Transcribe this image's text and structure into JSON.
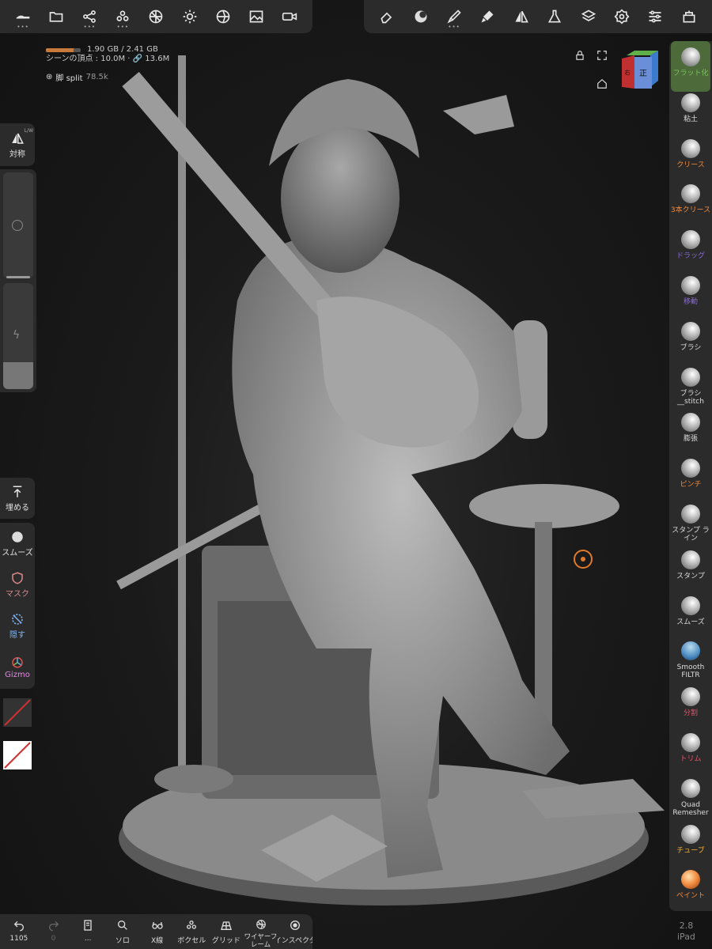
{
  "stats": {
    "memory": "1.90 GB / 2.41 GB",
    "memory_fraction": 0.79,
    "scene_vertices": "シーンの頂点 : 10.0M · ",
    "scene_link": "13.6M",
    "object_name": "脚 split",
    "object_count": "78.5k"
  },
  "top_left_tools": [
    "file-icon",
    "folder-icon",
    "scene-graph-icon",
    "multiresolution-icon",
    "topology-icon",
    "lighting-icon",
    "material-icon",
    "image-icon",
    "camera-icon"
  ],
  "top_right_tools": [
    "eraser-icon",
    "material-sphere-icon",
    "brush-icon",
    "paint-icon",
    "symmetry-icon",
    "flask-icon",
    "layers-icon",
    "settings-icon",
    "sliders-icon",
    "reference-icon"
  ],
  "cube": {
    "front_label": "正",
    "right_label": "右"
  },
  "left_panel": {
    "symmetry_label": "対称",
    "symmetry_badge": "L/W",
    "fill_label": "埋める",
    "smooth_label": "スムーズ",
    "mask_label": "マスク",
    "hide_label": "隠す",
    "gizmo_label": "Gizmo"
  },
  "right_tools": [
    {
      "label": "フラット化",
      "color": "#7bc35a",
      "active": true
    },
    {
      "label": "粘土",
      "color": "#dddddd"
    },
    {
      "label": "クリース",
      "color": "#f08a3e"
    },
    {
      "label": "3本クリース",
      "color": "#f08a3e"
    },
    {
      "label": "ドラッグ",
      "color": "#8a6ad6"
    },
    {
      "label": "移動",
      "color": "#8a6ad6"
    },
    {
      "label": "ブラシ",
      "color": "#dddddd"
    },
    {
      "label": "ブラシ__stitch",
      "color": "#dddddd"
    },
    {
      "label": "膨張",
      "color": "#dddddd"
    },
    {
      "label": "ピンチ",
      "color": "#f08a3e"
    },
    {
      "label": "スタンプ ライン",
      "color": "#dddddd"
    },
    {
      "label": "スタンプ",
      "color": "#dddddd"
    },
    {
      "label": "スムーズ",
      "color": "#dddddd"
    },
    {
      "label": "Smooth FILTR",
      "color": "#dddddd"
    },
    {
      "label": "分割",
      "color": "#e0556a"
    },
    {
      "label": "トリム",
      "color": "#e0556a"
    },
    {
      "label": "Quad Remesher",
      "color": "#dddddd"
    },
    {
      "label": "チューブ",
      "color": "#f0b030"
    },
    {
      "label": "ペイント",
      "color": "#f08a3e"
    }
  ],
  "bottom_bar": {
    "undo_count": "1105",
    "redo_count": "0",
    "items": [
      "...",
      "ソロ",
      "X線",
      "ボクセル",
      "グリッド",
      "ワイヤーフレーム",
      "インスペクタ"
    ]
  },
  "device": {
    "version": "2.8",
    "name": "iPad"
  },
  "colors": {
    "accent_active": "#4d6b3a",
    "panel_bg": "#2b2b2b",
    "target": "#e07a2b"
  }
}
